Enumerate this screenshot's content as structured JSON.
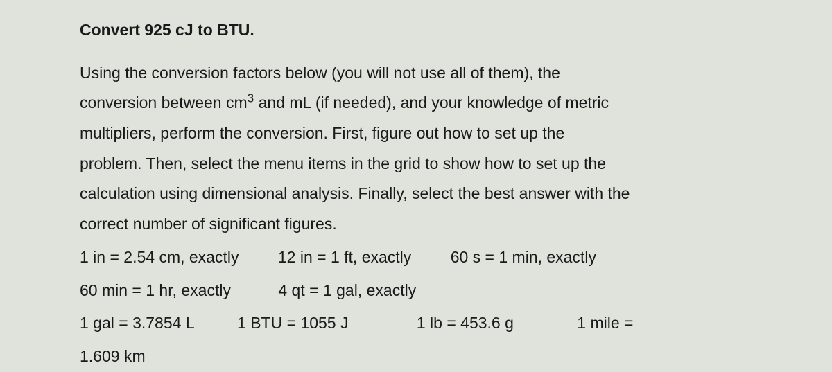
{
  "heading": "Convert 925 cJ to BTU.",
  "instructions": {
    "line1": "Using the conversion factors below (you will not use all of them), the",
    "line2_pre": "conversion between cm",
    "line2_sup": "3",
    "line2_post": " and mL (if needed), and your knowledge of metric",
    "line3": "multipliers, perform the conversion.  First, figure out how to set up the",
    "line4": "problem.  Then, select the menu items in the grid to show how to set up the",
    "line5": "calculation using dimensional analysis.  Finally, select the best answer with the",
    "line6": "correct number of significant figures."
  },
  "factors_row1": {
    "f1": "1 in = 2.54 cm, exactly",
    "f2": "12 in = 1 ft, exactly",
    "f3": "60 s = 1 min, exactly"
  },
  "factors_row2": {
    "f1": "60 min = 1 hr, exactly",
    "f2": "4 qt = 1 gal, exactly"
  },
  "factors_row3": {
    "f1": "1 gal = 3.7854 L",
    "f2": "1 BTU = 1055 J",
    "f3": "1 lb = 453.6 g",
    "f4": "1 mile ="
  },
  "factors_row4": {
    "f1": "1.609 km"
  }
}
